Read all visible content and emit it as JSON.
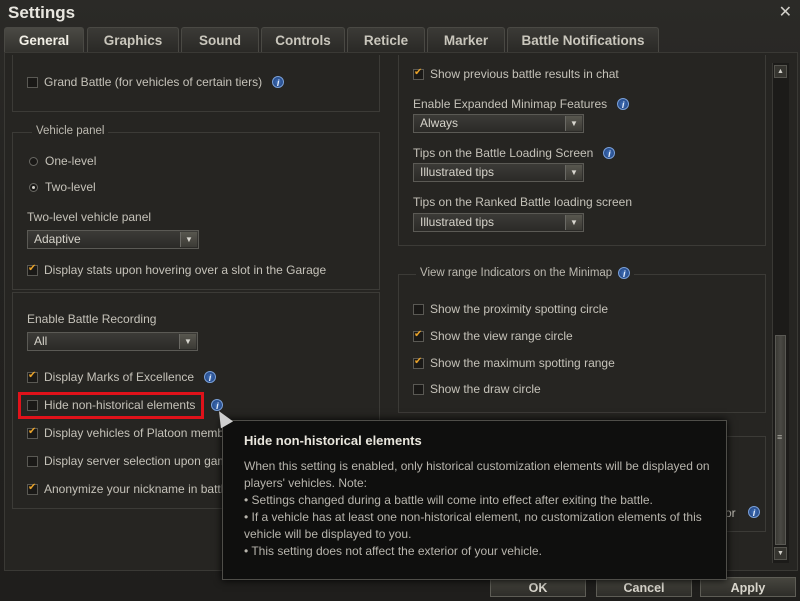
{
  "window": {
    "title": "Settings",
    "close_glyph": "✕"
  },
  "tabs": [
    {
      "label": "General",
      "active": true
    },
    {
      "label": "Graphics"
    },
    {
      "label": "Sound"
    },
    {
      "label": "Controls"
    },
    {
      "label": "Reticle"
    },
    {
      "label": "Marker"
    },
    {
      "label": "Battle Notifications"
    }
  ],
  "left": {
    "grand_battle": {
      "label": "Grand Battle (for vehicles of certain tiers)",
      "checked": false
    },
    "vehicle_panel": {
      "legend": "Vehicle panel",
      "one_level": "One-level",
      "two_level": "Two-level",
      "two_level_panel_label": "Two-level vehicle panel",
      "two_level_panel_value": "Adaptive",
      "display_stats": "Display stats upon hovering over a slot in the Garage"
    },
    "battle_recording_label": "Enable Battle Recording",
    "battle_recording_value": "All",
    "marks_of_excellence": "Display Marks of Excellence",
    "hide_non_historical": "Hide non-historical elements",
    "platoon_vehicles": "Display vehicles of Platoon memb",
    "server_selection": "Display server selection upon gam",
    "anonymize": "Anonymize your nickname in battl"
  },
  "right": {
    "previous_results": "Show previous battle results in chat",
    "minimap_features_label": "Enable Expanded Minimap Features",
    "minimap_features_value": "Always",
    "tips_loading_label": "Tips on the Battle Loading Screen",
    "tips_loading_value": "Illustrated tips",
    "tips_ranked_label": "Tips on the Ranked Battle loading screen",
    "tips_ranked_value": "Illustrated tips",
    "view_range_legend": "View range Indicators on the Minimap",
    "proximity": "Show the proximity spotting circle",
    "view_range": "Show the view range circle",
    "max_spotting": "Show the maximum spotting range",
    "draw_circle": "Show the draw circle",
    "partial_text": "or"
  },
  "tooltip": {
    "title": "Hide non-historical elements",
    "line1": "When this setting is enabled, only historical customization elements will be displayed on players' vehicles. Note:",
    "line2": "• Settings changed during a battle will come into effect after exiting the battle.",
    "line3": "• If a vehicle has at least one non-historical element, no customization elements of this vehicle will be displayed to you.",
    "line4": "• This setting does not affect the exterior of your vehicle."
  },
  "buttons": {
    "ok": "OK",
    "cancel": "Cancel",
    "apply": "Apply"
  },
  "colors": {
    "checkmark": "#e8a22a",
    "highlight": "#e0121a",
    "info": "#3f6fb8"
  }
}
